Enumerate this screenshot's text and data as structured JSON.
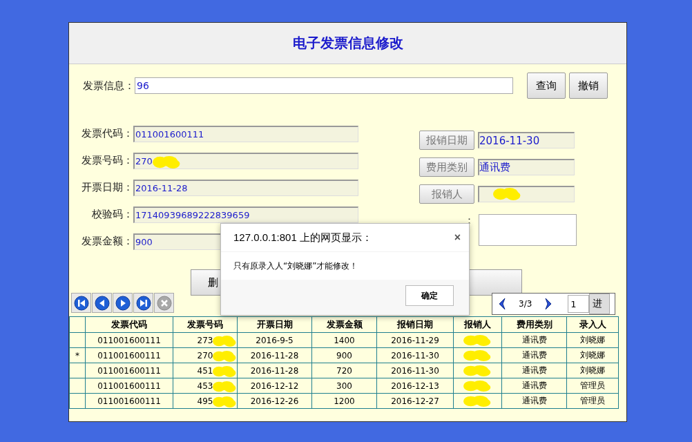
{
  "title": "电子发票信息修改",
  "search": {
    "label": "发票信息：",
    "value": "96",
    "buttons": [
      "查询",
      "撤销"
    ]
  },
  "fields": [
    {
      "label": "发票代码：",
      "value": "011001600111"
    },
    {
      "label": "发票号码：",
      "value": "270",
      "redacted": true
    },
    {
      "label": "开票日期：",
      "value": "2016-11-28"
    },
    {
      "label": "校验码：",
      "value": "17140939689222839659"
    },
    {
      "label": "发票金额：",
      "value": "900"
    }
  ],
  "side_fields": [
    {
      "button": "报销日期",
      "value": "2016-11-30"
    },
    {
      "button": "费用类别",
      "value": "通讯费"
    },
    {
      "button": "报销人",
      "redacted": true
    }
  ],
  "remark": {
    "label": "："
  },
  "action_buttons": [
    "删"
  ],
  "pager": {
    "page": "3/3",
    "page_input": "1",
    "go": "进"
  },
  "nav_buttons": [
    {
      "kind": "first",
      "disabled": false
    },
    {
      "kind": "prev",
      "disabled": false
    },
    {
      "kind": "next",
      "disabled": false
    },
    {
      "kind": "last",
      "disabled": false
    },
    {
      "kind": "cancel",
      "disabled": true
    }
  ],
  "table": {
    "columns": [
      "",
      "发票代码",
      "发票号码",
      "开票日期",
      "发票金额",
      "报销日期",
      "报销人",
      "费用类别",
      "录入人"
    ],
    "rows": [
      {
        "cells": [
          {
            "text": ""
          },
          {
            "text": "011001600111"
          },
          {
            "text": "273",
            "redacted": true
          },
          {
            "text": "2016-9-5"
          },
          {
            "text": "1400"
          },
          {
            "text": "2016-11-29"
          },
          {
            "redacted": true
          },
          {
            "text": "通讯费"
          },
          {
            "text": "刘晓娜"
          }
        ]
      },
      {
        "cells": [
          {
            "text": "*"
          },
          {
            "text": "011001600111"
          },
          {
            "text": "270",
            "redacted": true
          },
          {
            "text": "2016-11-28"
          },
          {
            "text": "900"
          },
          {
            "text": "2016-11-30"
          },
          {
            "redacted": true
          },
          {
            "text": "通讯费"
          },
          {
            "text": "刘晓娜"
          }
        ]
      },
      {
        "cells": [
          {
            "text": ""
          },
          {
            "text": "011001600111"
          },
          {
            "text": "451",
            "redacted": true
          },
          {
            "text": "2016-11-28"
          },
          {
            "text": "720"
          },
          {
            "text": "2016-11-30"
          },
          {
            "redacted": true
          },
          {
            "text": "通讯费"
          },
          {
            "text": "刘晓娜"
          }
        ]
      },
      {
        "cells": [
          {
            "text": ""
          },
          {
            "text": "011001600111"
          },
          {
            "text": "453",
            "redacted": true
          },
          {
            "text": "2016-12-12"
          },
          {
            "text": "300"
          },
          {
            "text": "2016-12-13"
          },
          {
            "redacted": true
          },
          {
            "text": "通讯费"
          },
          {
            "text": "管理员"
          }
        ]
      },
      {
        "cells": [
          {
            "text": ""
          },
          {
            "text": "011001600111"
          },
          {
            "text": "495",
            "redacted": true
          },
          {
            "text": "2016-12-26"
          },
          {
            "text": "1200"
          },
          {
            "text": "2016-12-27"
          },
          {
            "redacted": true
          },
          {
            "text": "通讯费"
          },
          {
            "text": "管理员"
          }
        ]
      }
    ]
  },
  "dialog": {
    "title": "127.0.0.1:801 上的网页显示：",
    "close": "×",
    "message": "只有原录入人“刘晓娜”才能修改！",
    "ok": "确定"
  }
}
